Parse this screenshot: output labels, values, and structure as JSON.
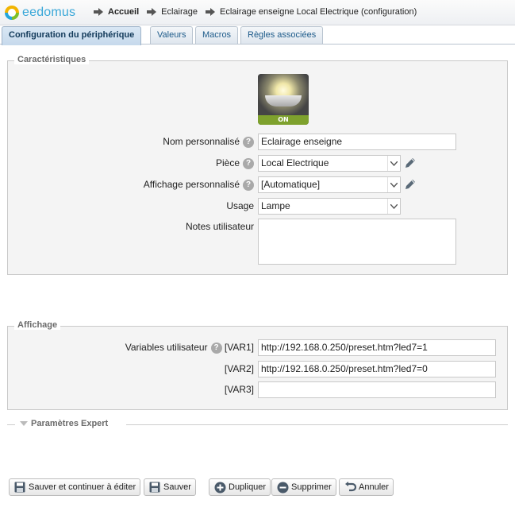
{
  "app": {
    "name": "eedomus"
  },
  "breadcrumb": [
    {
      "label": "Accueil",
      "bold": true
    },
    {
      "label": "Eclairage",
      "bold": false
    },
    {
      "label": "Eclairage enseigne Local Electrique (configuration)",
      "bold": false
    }
  ],
  "tabs": [
    {
      "label": "Configuration du périphérique",
      "active": true
    },
    {
      "label": "Valeurs",
      "active": false
    },
    {
      "label": "Macros",
      "active": false
    },
    {
      "label": "Règles associées",
      "active": false
    }
  ],
  "characteristics": {
    "legend": "Caractéristiques",
    "device_icon": {
      "name": "lamp-on-icon",
      "badge": "ON"
    },
    "name_label": "Nom personnalisé",
    "name_value": "Eclairage enseigne",
    "room_label": "Pièce",
    "room_value": "Local Electrique",
    "display_label": "Affichage personnalisé",
    "display_value": "[Automatique]",
    "usage_label": "Usage",
    "usage_value": "Lampe",
    "notes_label": "Notes utilisateur",
    "notes_value": ""
  },
  "display_section": {
    "legend": "Affichage",
    "vars_label": "Variables utilisateur",
    "vars": [
      {
        "tag": "[VAR1]",
        "value": "http://192.168.0.250/preset.htm?led7=1"
      },
      {
        "tag": "[VAR2]",
        "value": "http://192.168.0.250/preset.htm?led7=0"
      },
      {
        "tag": "[VAR3]",
        "value": ""
      }
    ]
  },
  "expert": {
    "label": "Paramètres Expert"
  },
  "buttons": {
    "save_continue": "Sauver et continuer à éditer",
    "save": "Sauver",
    "duplicate": "Dupliquer",
    "delete": "Supprimer",
    "cancel": "Annuler"
  },
  "colors": {
    "tab_text": "#1d5b8a",
    "on_badge": "#7ea12d",
    "logo": "#39a7d8"
  }
}
